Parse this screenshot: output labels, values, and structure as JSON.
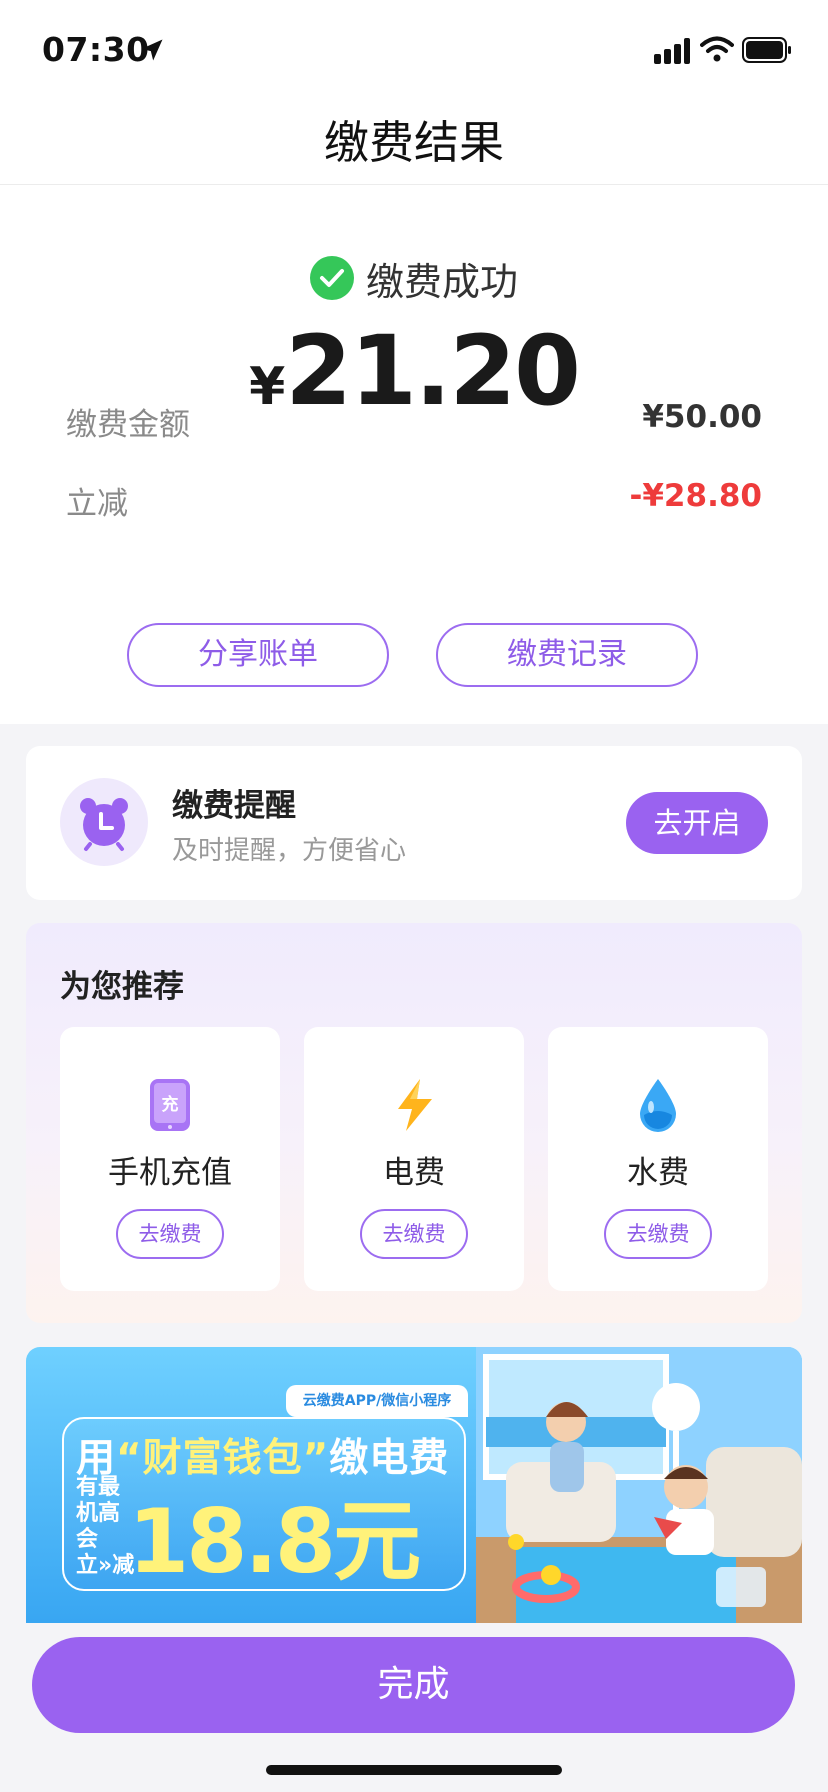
{
  "status_bar": {
    "time": "07:30"
  },
  "nav": {
    "title": "缴费结果"
  },
  "result": {
    "status": "缴费成功",
    "currency": "¥",
    "amount": "21.20",
    "rows": [
      {
        "label": "缴费金额",
        "value": "¥50.00"
      },
      {
        "label": "立减",
        "value": "-¥28.80"
      }
    ],
    "share_label": "分享账单",
    "records_label": "缴费记录"
  },
  "reminder": {
    "title": "缴费提醒",
    "subtitle": "及时提醒，方便省心",
    "button_label": "去开启"
  },
  "recommend": {
    "title": "为您推荐",
    "items": [
      {
        "name": "手机充值",
        "button": "去缴费",
        "icon": "phone-recharge-icon",
        "icon_char": "充"
      },
      {
        "name": "电费",
        "button": "去缴费",
        "icon": "lightning-icon"
      },
      {
        "name": "水费",
        "button": "去缴费",
        "icon": "water-drop-icon"
      }
    ]
  },
  "banner": {
    "tag": "云缴费APP/微信小程序",
    "headline_prefix": "用",
    "headline_quote": "“财富钱包”",
    "headline_suffix": "缴电费",
    "side_text": "有最机高会立»减",
    "big_text": "18.8元"
  },
  "footer": {
    "done_label": "完成"
  },
  "colors": {
    "accent": "#9a62f0",
    "success": "#35c759",
    "discount": "#ee3b3b"
  }
}
